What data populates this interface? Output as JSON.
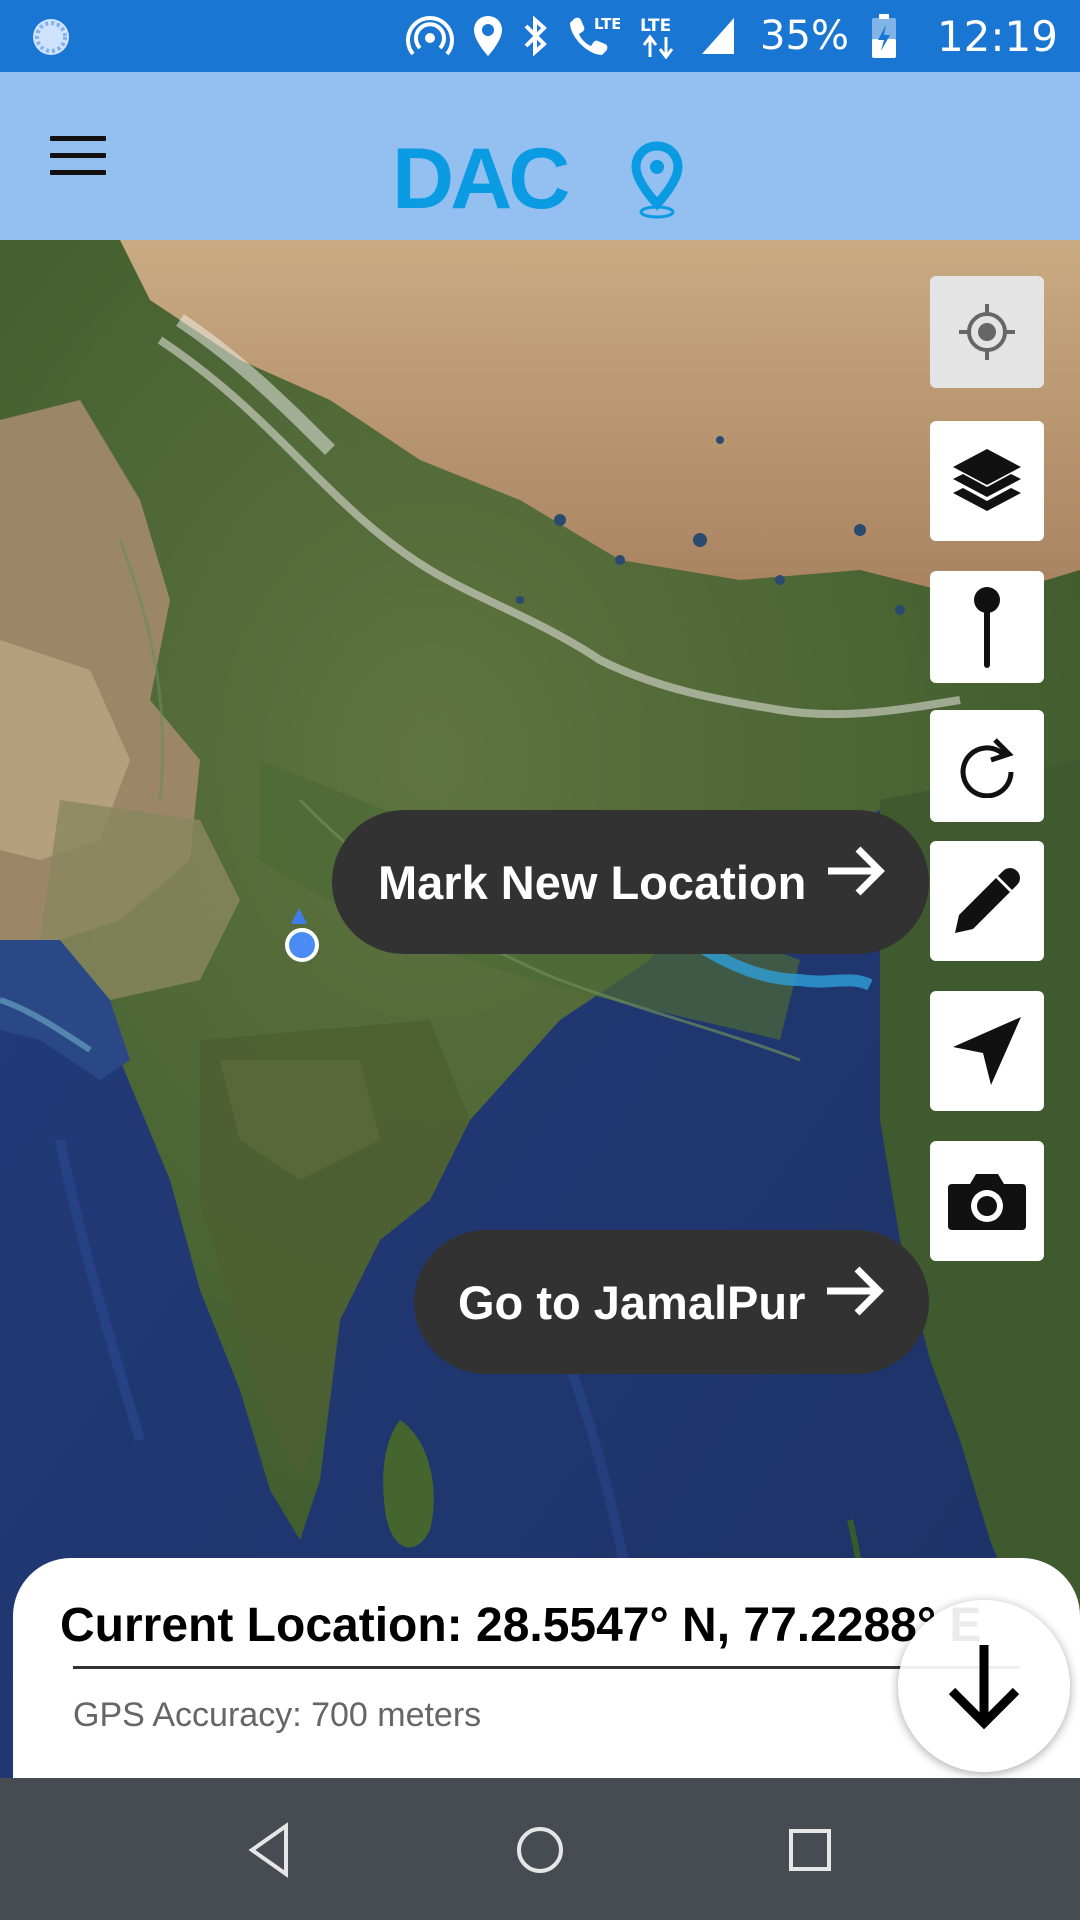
{
  "status_bar": {
    "battery_percent": "35%",
    "time": "12:19",
    "icons": [
      "sync-icon",
      "hotspot-icon",
      "location-icon",
      "bluetooth-icon",
      "lte-call-icon",
      "lte-data-icon",
      "signal-icon",
      "battery-charging-icon"
    ],
    "lte_label": "LTE",
    "color": "#1976d2"
  },
  "app_bar": {
    "logo_text": "DAC",
    "menu_icon": "hamburger-icon",
    "color": "#93c0f0",
    "logo_color": "#0a9be3"
  },
  "map": {
    "actions": {
      "mark_new_location": "Mark New Location",
      "go_to_jamalpur": "Go to JamalPur"
    },
    "tools": [
      "my-location-icon",
      "layers-icon",
      "pin-icon",
      "refresh-icon",
      "pencil-icon",
      "navigation-icon",
      "camera-icon"
    ]
  },
  "location_panel": {
    "current_location": "Current Location: 28.5547° N, 77.2288° E",
    "gps_accuracy": "GPS Accuracy: 700 meters"
  },
  "nav_bar": {
    "icons": [
      "back-icon",
      "home-icon",
      "recents-icon"
    ]
  }
}
